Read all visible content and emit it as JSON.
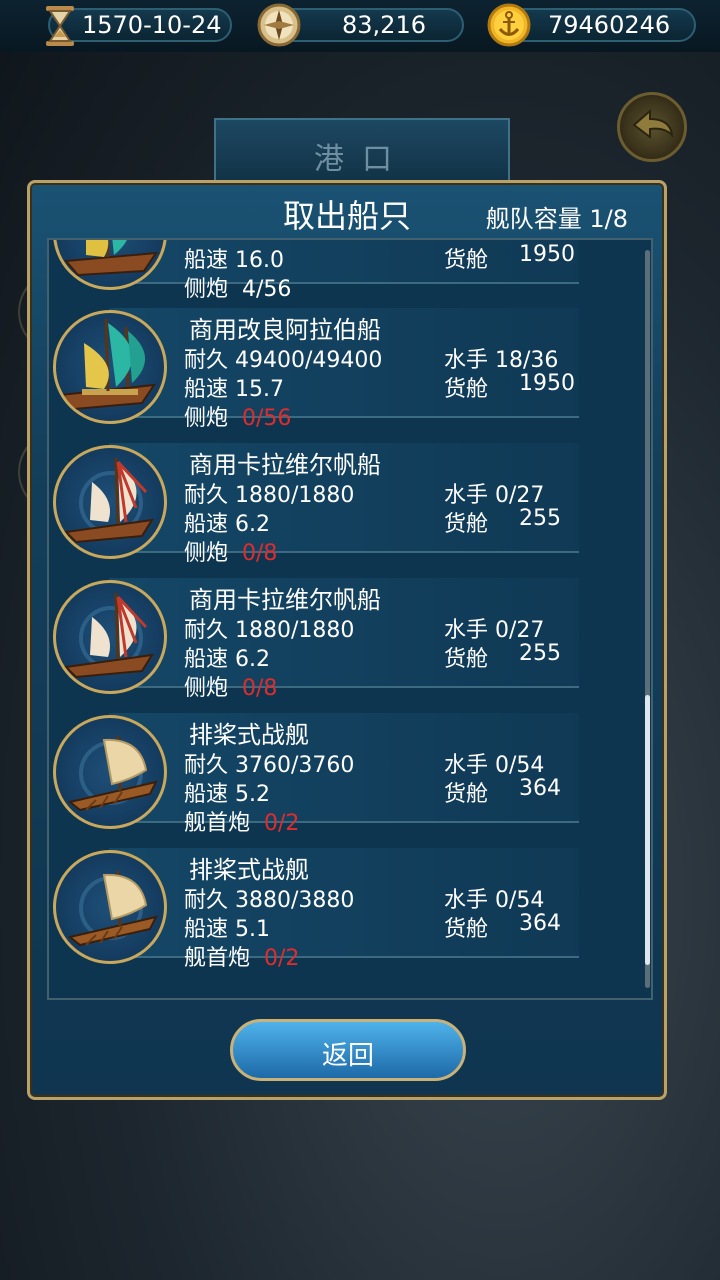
{
  "topbar": {
    "date": "1570-10-24",
    "compass_value": "83,216",
    "gold_value": "79460246",
    "date_icon": "hourglass-icon",
    "compass_icon": "compass-icon",
    "gold_icon": "anchor-coin-icon"
  },
  "background": {
    "port_title": "港口"
  },
  "dialog": {
    "title": "取出船只",
    "capacity_label": "舰队容量 1/8",
    "return_label": "返回"
  },
  "ships": [
    {
      "name": "",
      "speed": "船速 16.0",
      "cargo_label": "货舱",
      "cargo": "1950",
      "weapon_label": "侧炮",
      "weapon_value": "4/56",
      "weapon_red": false
    },
    {
      "name": "商用改良阿拉伯船",
      "durability": "耐久 49400/49400",
      "crew": "水手 18/36",
      "speed": "船速 15.7",
      "cargo_label": "货舱",
      "cargo": "1950",
      "weapon_label": "侧炮",
      "weapon_value": "0/56",
      "weapon_red": true
    },
    {
      "name": "商用卡拉维尔帆船",
      "durability": "耐久 1880/1880",
      "crew": "水手 0/27",
      "speed": "船速 6.2",
      "cargo_label": "货舱",
      "cargo": "255",
      "weapon_label": "侧炮",
      "weapon_value": "0/8",
      "weapon_red": true
    },
    {
      "name": "商用卡拉维尔帆船",
      "durability": "耐久 1880/1880",
      "crew": "水手 0/27",
      "speed": "船速 6.2",
      "cargo_label": "货舱",
      "cargo": "255",
      "weapon_label": "侧炮",
      "weapon_value": "0/8",
      "weapon_red": true
    },
    {
      "name": "排桨式战舰",
      "durability": "耐久 3760/3760",
      "crew": "水手 0/54",
      "speed": "船速 5.2",
      "cargo_label": "货舱",
      "cargo": "364",
      "weapon_label": "舰首炮",
      "weapon_value": "0/2",
      "weapon_red": true
    },
    {
      "name": "排桨式战舰",
      "durability": "耐久 3880/3880",
      "crew": "水手 0/54",
      "speed": "船速 5.1",
      "cargo_label": "货舱",
      "cargo": "364",
      "weapon_label": "舰首炮",
      "weapon_value": "0/2",
      "weapon_red": true
    }
  ],
  "colors": {
    "accent_gold": "#c8a85c",
    "warning_red": "#e02c2c",
    "panel_blue": "#133f5b"
  }
}
